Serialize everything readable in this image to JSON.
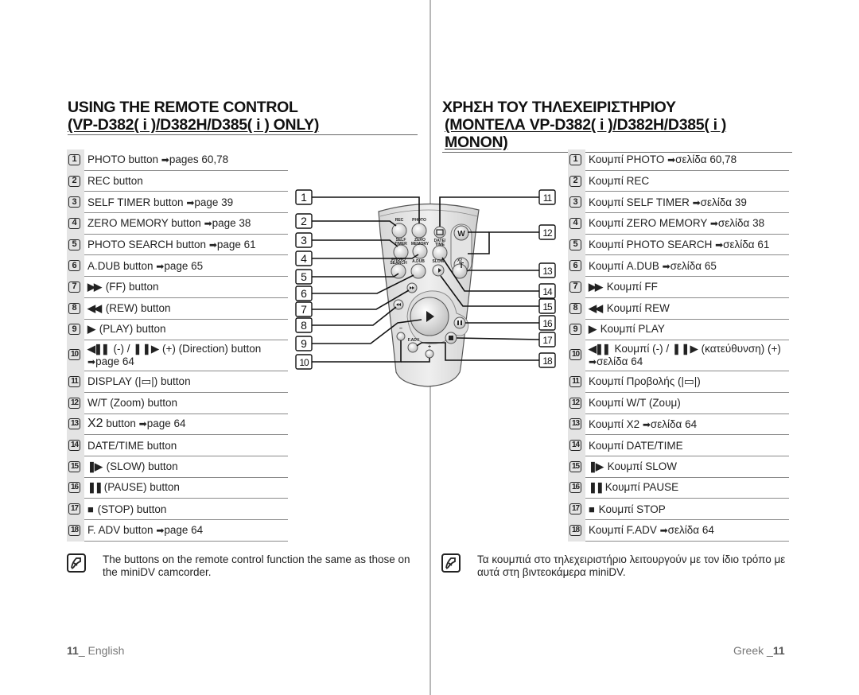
{
  "english": {
    "title_line1": "USING THE REMOTE CONTROL",
    "title_line2": "(VP-D382( i )/D382H/D385( i ) ONLY)",
    "items": [
      {
        "n": "1",
        "text": "PHOTO button ",
        "ref": "pages 60,78"
      },
      {
        "n": "2",
        "text": "REC button",
        "ref": ""
      },
      {
        "n": "3",
        "text": "SELF TIMER button ",
        "ref": "page 39"
      },
      {
        "n": "4",
        "text": "ZERO MEMORY button ",
        "ref": "page 38"
      },
      {
        "n": "5",
        "text": "PHOTO SEARCH button ",
        "ref": "page 61"
      },
      {
        "n": "6",
        "text": "A.DUB button ",
        "ref": "page 65"
      },
      {
        "n": "7",
        "glyph": "▶▶",
        "text": " (FF) button",
        "ref": ""
      },
      {
        "n": "8",
        "glyph": "◀◀",
        "text": " (REW) button",
        "ref": ""
      },
      {
        "n": "9",
        "glyph": "▶",
        "text": " (PLAY) button",
        "ref": ""
      },
      {
        "n": "10",
        "glyph": "◀❚❚",
        "text": " (-) / ❚❚▶ (+) (Direction) button",
        "ref": "page 64",
        "tall": true
      },
      {
        "n": "11",
        "text": "DISPLAY (|▭|) button",
        "ref": ""
      },
      {
        "n": "12",
        "text": "W/T (Zoom) button",
        "ref": ""
      },
      {
        "n": "13",
        "x2": "X2",
        "text": " button ",
        "ref": "page 64"
      },
      {
        "n": "14",
        "text": "DATE/TIME button",
        "ref": ""
      },
      {
        "n": "15",
        "glyph": "❚▶",
        "text": " (SLOW) button",
        "ref": ""
      },
      {
        "n": "16",
        "glyph": "❚❚",
        "text": "(PAUSE) button",
        "ref": ""
      },
      {
        "n": "17",
        "glyph": "■",
        "text": " (STOP) button",
        "ref": ""
      },
      {
        "n": "18",
        "text": "F. ADV button ",
        "ref": "page 64"
      }
    ],
    "note": "The buttons on the remote control function the same as those on the miniDV camcorder.",
    "footer_page": "11",
    "footer_lang": "_ English"
  },
  "greek": {
    "title_line1": "ΧΡΗΣΗ ΤΟΥ ΤΗΛΕΧΕΙΡΙΣΤΗΡΙΟΥ",
    "title_line2": "(ΜΟΝΤΕΛΑ VP-D382( i )/D382H/D385( i ) ΜΟΝΟΝ)",
    "items": [
      {
        "n": "1",
        "text": "Κουμπί PHOTO  ",
        "ref": "σελίδα  60,78"
      },
      {
        "n": "2",
        "text": "Κουμπί REC",
        "ref": ""
      },
      {
        "n": "3",
        "text": "Κουμπί SELF TIMER ",
        "ref": "σελίδα 39"
      },
      {
        "n": "4",
        "text": "Κουμπί ZERO MEMORY  ",
        "ref": "σελίδα 38"
      },
      {
        "n": "5",
        "text": "Κουμπί PHOTO SEARCH  ",
        "ref": "σελίδα 61"
      },
      {
        "n": "6",
        "text": "Κουμπί A.DUB  ",
        "ref": "σελίδα  65"
      },
      {
        "n": "7",
        "glyph": "▶▶",
        "text": " Κουμπί FF",
        "ref": ""
      },
      {
        "n": "8",
        "glyph": "◀◀",
        "text": " Κουμπί REW",
        "ref": ""
      },
      {
        "n": "9",
        "glyph": "▶",
        "text": " Κουμπί PLAY",
        "ref": ""
      },
      {
        "n": "10",
        "glyph": "◀❚❚",
        "text": " Κουμπί (-) / ❚❚▶ (κατεύθυνση) (+)",
        "ref": "σελίδα  64",
        "tall": true
      },
      {
        "n": "11",
        "text": "Κουμπί Προβολής (|▭|)",
        "ref": ""
      },
      {
        "n": "12",
        "text": "Κουμπί W/T (Ζουμ)",
        "ref": ""
      },
      {
        "n": "13",
        "text": "Κουμπί X2 ",
        "ref": "σελίδα 64"
      },
      {
        "n": "14",
        "text": "Κουμπί DATE/TIME",
        "ref": ""
      },
      {
        "n": "15",
        "glyph": "❚▶",
        "text": " Κουμπί SLOW",
        "ref": ""
      },
      {
        "n": "16",
        "glyph": "❚❚",
        "text": "Κουμπί PAUSE",
        "ref": ""
      },
      {
        "n": "17",
        "glyph": "■",
        "text": " Κουμπί STOP",
        "ref": ""
      },
      {
        "n": "18",
        "text": "Κουμπί F.ADV ",
        "ref": "σελίδα 64"
      }
    ],
    "note": "Τα κουμπιά στο τηλεχειριστήριο λειτουργούν με τον ίδιο τρόπο με αυτά στη βιντεοκάμερα miniDV.",
    "footer_lang": "Greek _",
    "footer_page": "11"
  },
  "remote": {
    "labels": {
      "rec": "REC",
      "photo": "PHOTO",
      "self_timer_1": "SELF",
      "self_timer_2": "TIMER",
      "zero_memory_1": "ZERO",
      "zero_memory_2": "MEMORY",
      "date_time_1": "DATE/",
      "date_time_2": "TIME",
      "photo_search_1": "PHOTO",
      "photo_search_2": "SEARCH",
      "a_dub": "A.DUB",
      "slow": "SLOW",
      "x2": "X2",
      "w": "W",
      "t": "T",
      "f_adv": "F.ADV",
      "minus": "–",
      "plus": "+"
    },
    "callouts": [
      "1",
      "2",
      "3",
      "4",
      "5",
      "6",
      "7",
      "8",
      "9",
      "10",
      "11",
      "12",
      "13",
      "14",
      "15",
      "16",
      "17",
      "18"
    ]
  }
}
